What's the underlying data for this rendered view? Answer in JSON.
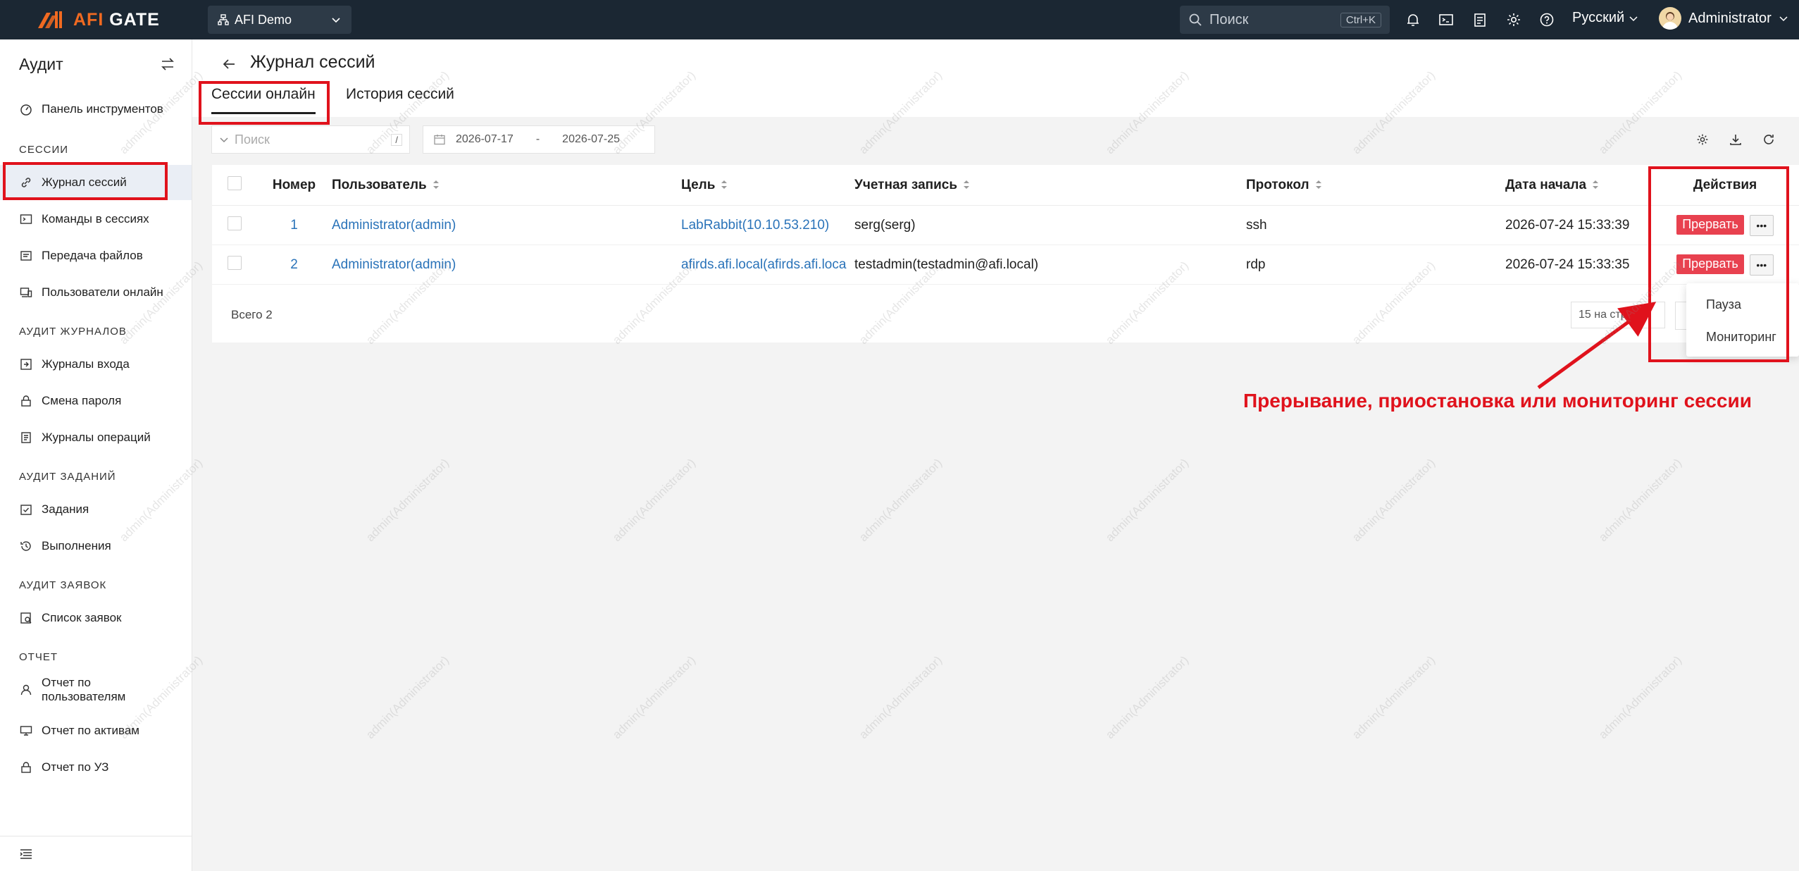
{
  "brand": {
    "name": "AFI GATE",
    "accent": "#f16a21"
  },
  "header": {
    "org": "AFI Demo",
    "search_placeholder": "Поиск",
    "search_shortcut": "Ctrl+K",
    "language": "Русский",
    "user": "Administrator",
    "icons": [
      "bell-icon",
      "terminal-icon",
      "clipboard-icon",
      "gear-icon",
      "help-icon"
    ]
  },
  "sidebar": {
    "title": "Аудит",
    "dashboard": "Панель инструментов",
    "groups": [
      {
        "title": "СЕССИИ",
        "items": [
          "Журнал сессий",
          "Команды в сессиях",
          "Передача файлов",
          "Пользователи онлайн"
        ]
      },
      {
        "title": "АУДИТ ЖУРНАЛОВ",
        "items": [
          "Журналы входа",
          "Смена пароля",
          "Журналы операций"
        ]
      },
      {
        "title": "АУДИТ ЗАДАНИЙ",
        "items": [
          "Задания",
          "Выполнения"
        ]
      },
      {
        "title": "АУДИТ ЗАЯВОК",
        "items": [
          "Список заявок"
        ]
      },
      {
        "title": "ОТЧЕТ",
        "items": [
          "Отчет по пользователям",
          "Отчет по активам",
          "Отчет по УЗ"
        ]
      }
    ],
    "active": "Журнал сессий"
  },
  "page": {
    "title": "Журнал сессий",
    "tabs": [
      "Сессии онлайн",
      "История сессий"
    ],
    "active_tab": "Сессии онлайн"
  },
  "filters": {
    "search_placeholder": "Поиск",
    "search_hint": "/",
    "date_from": "2026-07-17",
    "date_sep": "-",
    "date_to": "2026-07-25"
  },
  "table": {
    "columns": [
      "Номер",
      "Пользователь",
      "Цель",
      "Учетная запись",
      "Протокол",
      "Дата начала",
      "Действия"
    ],
    "rows": [
      {
        "num": "1",
        "user": "Administrator(admin)",
        "target": "LabRabbit(10.10.53.210)",
        "account": "serg(serg)",
        "protocol": "ssh",
        "start": "2026-07-24 15:33:39",
        "action": "Прервать"
      },
      {
        "num": "2",
        "user": "Administrator(admin)",
        "target": "afirds.afi.local(afirds.afi.loca",
        "account": "testadmin(testadmin@afi.local)",
        "protocol": "rdp",
        "start": "2026-07-24 15:33:35",
        "action": "Прервать"
      }
    ],
    "total": "Всего 2",
    "page_size": "15 на стр..."
  },
  "dropdown": [
    "Пауза",
    "Мониторинг"
  ],
  "annotation": "Прерывание, приостановка или мониторинг сессии",
  "watermark": "admin(Administrator)",
  "colors": {
    "topbar": "#1b2733",
    "link": "#2a73b9",
    "danger": "#e8414f",
    "highlight": "#e0121c"
  }
}
